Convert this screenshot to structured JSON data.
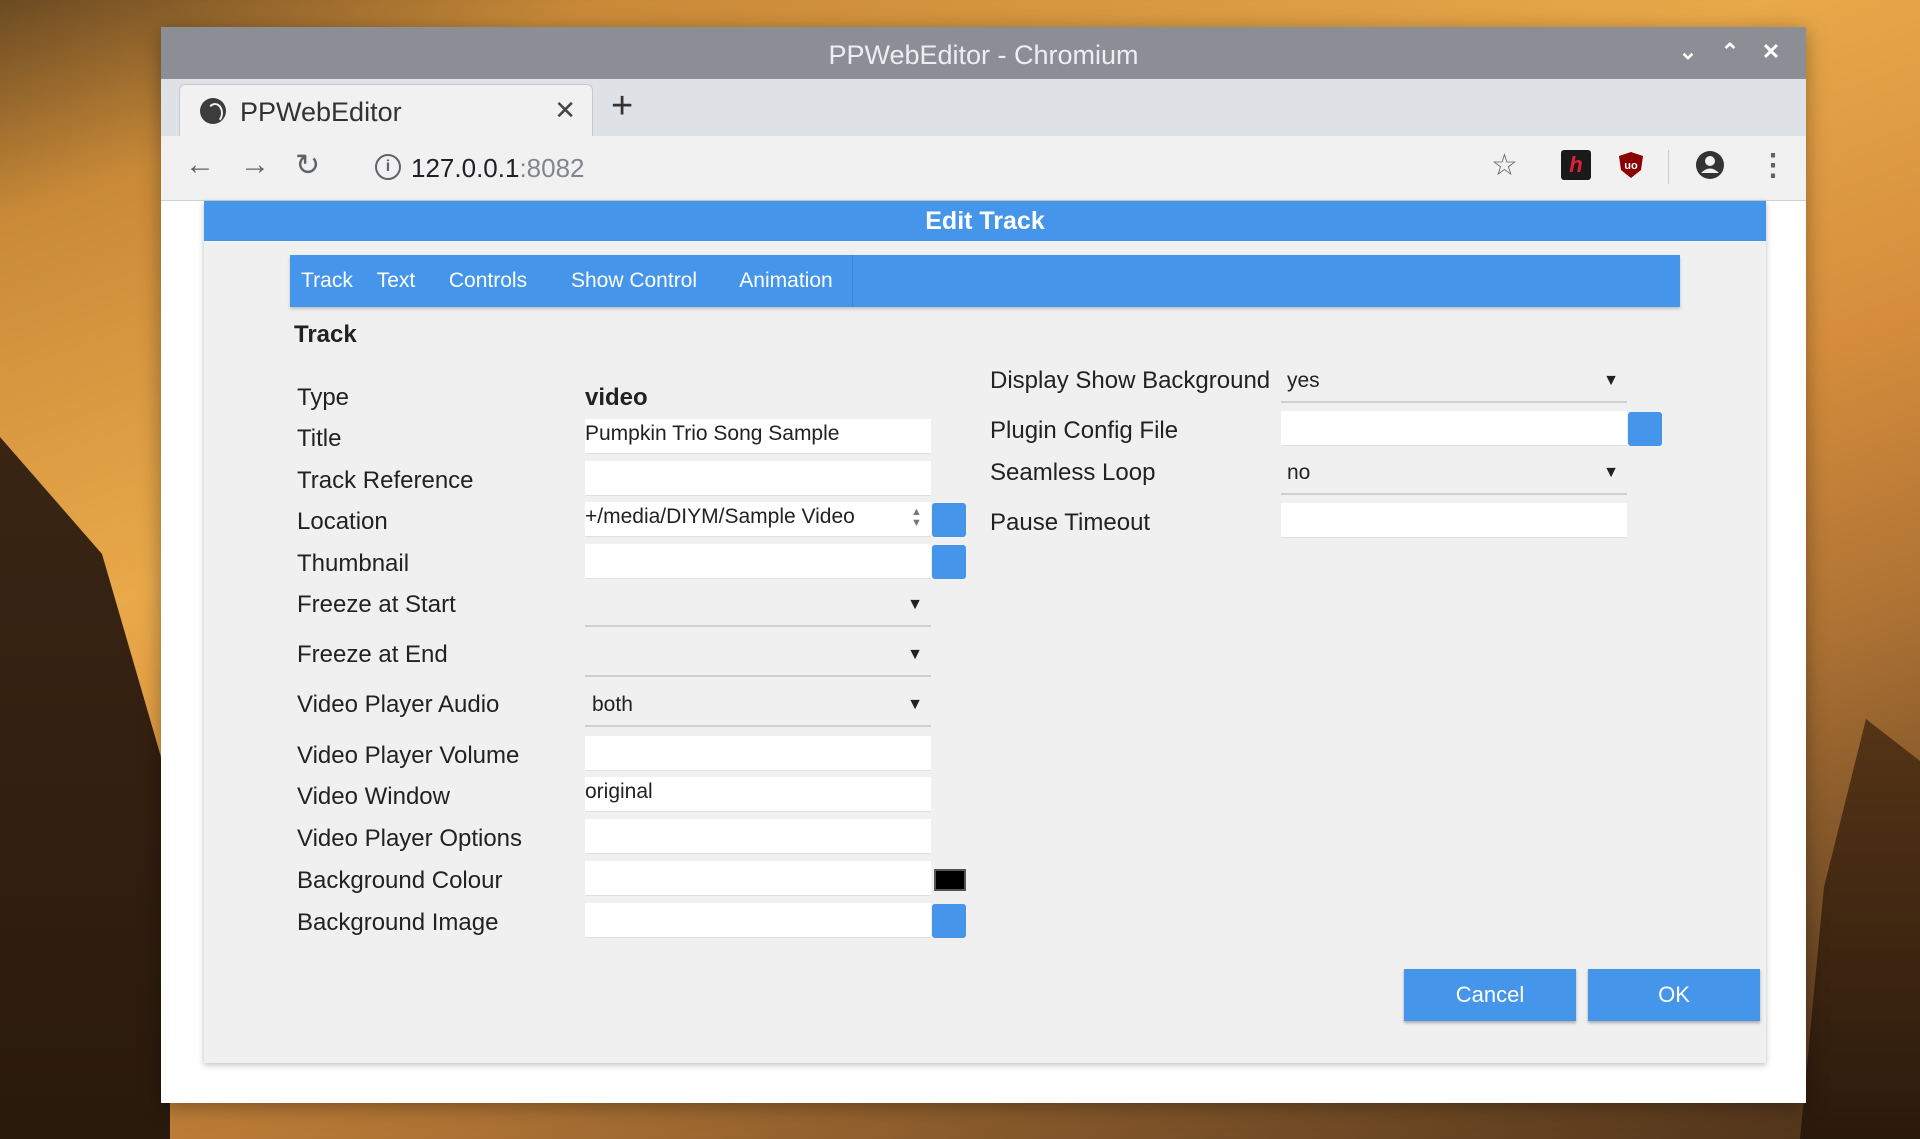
{
  "window": {
    "title": "PPWebEditor - Chromium",
    "controls": {
      "minimize": "⌄",
      "maximize": "⌃",
      "close": "✕"
    }
  },
  "browser": {
    "tab_title": "PPWebEditor",
    "tab_close": "✕",
    "new_tab": "+",
    "url_host": "127.0.0.1",
    "url_port": ":8082",
    "icons": [
      "back-icon",
      "forward-icon",
      "reload-icon",
      "info-icon",
      "star-icon",
      "extension-icon",
      "ublock-icon",
      "profile-icon",
      "menu-icon"
    ]
  },
  "dialog": {
    "title": "Edit Track",
    "tabs": [
      "Track",
      "Text",
      "Controls",
      "Show Control",
      "Animation"
    ],
    "section_title": "Track",
    "left_fields": {
      "type_label": "Type",
      "type_value": "video",
      "title_label": "Title",
      "title_value": "Pumpkin Trio Song Sample",
      "track_reference_label": "Track Reference",
      "track_reference_value": "",
      "location_label": "Location",
      "location_value": "+/media/DIYM/Sample Video",
      "thumbnail_label": "Thumbnail",
      "thumbnail_value": "",
      "freeze_start_label": "Freeze at Start",
      "freeze_start_value": "",
      "freeze_end_label": "Freeze at End",
      "freeze_end_value": "",
      "audio_label": "Video Player Audio",
      "audio_value": "both",
      "volume_label": "Video Player Volume",
      "volume_value": "",
      "window_label": "Video Window",
      "window_value": "original",
      "options_label": "Video Player Options",
      "options_value": "",
      "bg_colour_label": "Background Colour",
      "bg_colour_value": "",
      "bg_image_label": "Background Image",
      "bg_image_value": ""
    },
    "right_fields": {
      "display_bg_label": "Display Show Background",
      "display_bg_value": "yes",
      "plugin_label": "Plugin Config File",
      "plugin_value": "",
      "seamless_label": "Seamless Loop",
      "seamless_value": "no",
      "pause_label": "Pause Timeout",
      "pause_value": ""
    },
    "buttons": {
      "cancel": "Cancel",
      "ok": "OK"
    },
    "colors": {
      "accent": "#4596ea",
      "swatch": "#000000"
    }
  }
}
